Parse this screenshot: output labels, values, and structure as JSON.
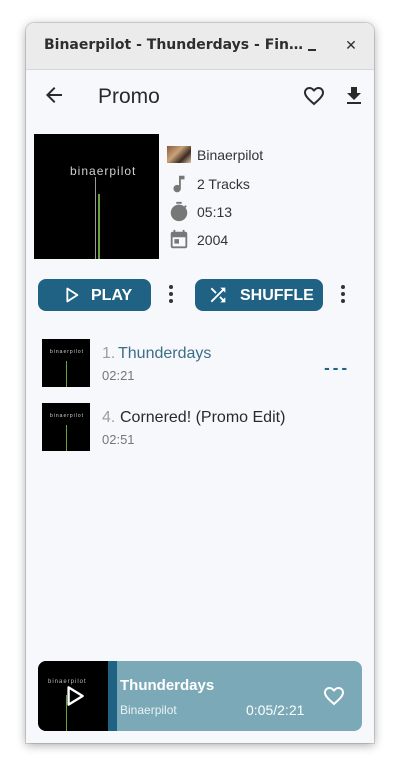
{
  "window": {
    "title": "Binaerpilot - Thunderdays - Fin…",
    "minimize_icon": "minimize-icon",
    "close_label": "✕"
  },
  "appbar": {
    "back_icon": "arrow-left-icon",
    "title": "Promo",
    "favorite_icon": "heart-outline-icon",
    "download_icon": "download-icon"
  },
  "album": {
    "cover_text": "binaerpilot",
    "artist": "Binaerpilot",
    "tracks": "2 Tracks",
    "duration": "05:13",
    "year": "2004"
  },
  "actions": {
    "play_label": "PLAY",
    "shuffle_label": "SHUFFLE"
  },
  "tracks": [
    {
      "number": "1.",
      "title": "Thunderdays",
      "duration": "02:21",
      "playing": true
    },
    {
      "number": "4.",
      "title": "Cornered! (Promo Edit)",
      "duration": "02:51",
      "playing": false
    }
  ],
  "now_playing": {
    "title": "Thunderdays",
    "artist": "Binaerpilot",
    "position": "0:05",
    "length": "2:21",
    "progress_fraction": 0.04
  },
  "colors": {
    "accent": "#1f6283",
    "player_bg": "#7ba9b8",
    "playing_title": "#3d6e86"
  }
}
